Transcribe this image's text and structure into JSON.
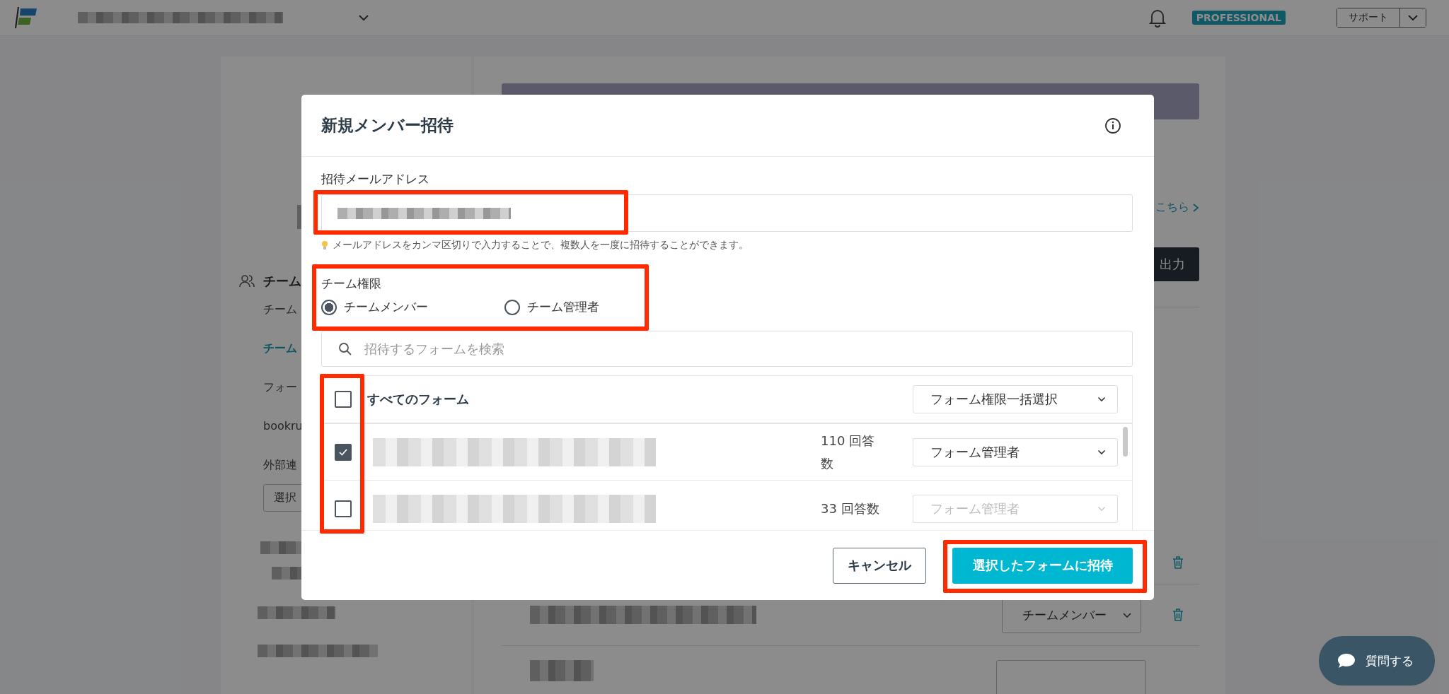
{
  "header": {
    "badge": "PROFESSIONAL",
    "support_button": "サポート"
  },
  "sidebar": {
    "section": "チーム",
    "items": [
      {
        "label": "チーム",
        "selected": false
      },
      {
        "label": "チーム",
        "selected": true
      },
      {
        "label": "フォー",
        "selected": false
      },
      {
        "label": "bookru",
        "selected": false
      },
      {
        "label": "外部連",
        "selected": false
      }
    ],
    "select_button": "選択"
  },
  "main": {
    "link": "こちら",
    "export_button": "出力",
    "role_select": "チームメンバー"
  },
  "chat_button": "質問する",
  "dialog": {
    "title": "新規メンバー招待",
    "email": {
      "label": "招待メールアドレス",
      "highlighted": true
    },
    "hint": "メールアドレスをカンマ区切りで入力することで、複数人を一度に招待することができます。",
    "role": {
      "label": "チーム権限",
      "highlighted": true,
      "options": [
        {
          "label": "チームメンバー",
          "selected": true
        },
        {
          "label": "チーム管理者",
          "selected": false
        }
      ]
    },
    "search": {
      "placeholder": "招待するフォームを検索"
    },
    "forms": {
      "checkbox_highlighted": true,
      "all": {
        "label": "すべてのフォーム",
        "checked": false,
        "bulk_select": "フォーム権限一括選択"
      },
      "rows": [
        {
          "checked": true,
          "responses": "110 回答数",
          "permission": "フォーム管理者",
          "disabled": false
        },
        {
          "checked": false,
          "responses": "33 回答数",
          "permission": "フォーム管理者",
          "disabled": true
        }
      ]
    },
    "buttons": {
      "cancel": "キャンセル",
      "submit": "選択したフォームに招待",
      "submit_highlighted": true
    }
  }
}
